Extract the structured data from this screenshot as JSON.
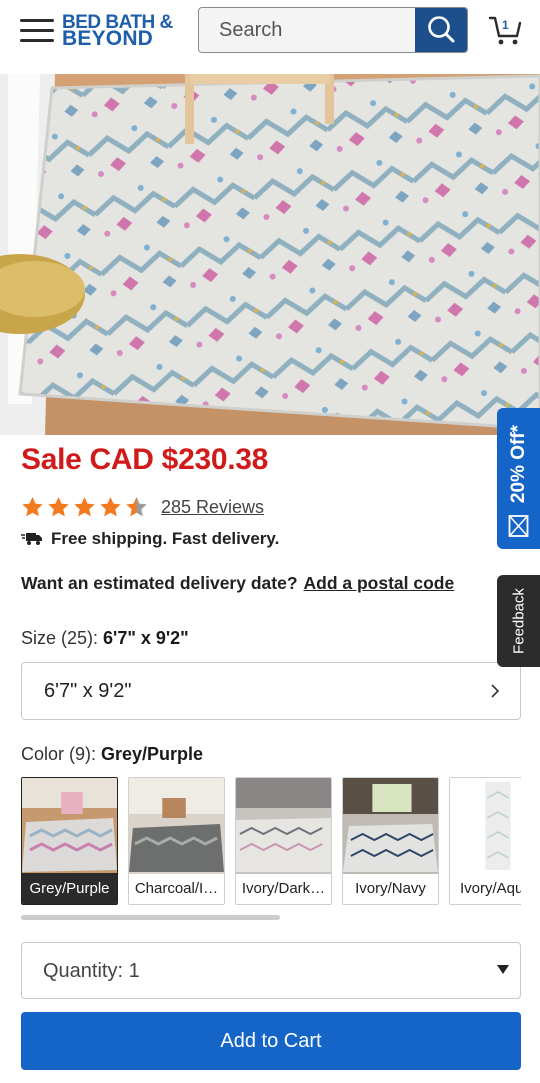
{
  "header": {
    "logo_line1": "BED BATH &",
    "logo_line2": "BEYOND",
    "search_placeholder": "Search",
    "cart_count": "1"
  },
  "product": {
    "price": "Sale CAD $230.38",
    "rating": 4.5,
    "reviews": "285 Reviews",
    "shipping": "Free shipping. Fast delivery.",
    "delivery_prompt": "Want an estimated delivery date?",
    "delivery_link": "Add a postal code",
    "size_label": "Size (25): ",
    "size_selected": "6'7\" x 9'2\"",
    "size_value": "6'7\" x 9'2\"",
    "color_label": "Color (9): ",
    "color_selected": "Grey/Purple",
    "swatches": [
      {
        "label": "Grey/Purple"
      },
      {
        "label": "Charcoal/I…"
      },
      {
        "label": "Ivory/Dark…"
      },
      {
        "label": "Ivory/Navy"
      },
      {
        "label": "Ivory/Aqu"
      }
    ],
    "quantity": "Quantity: 1",
    "add_to_cart": "Add to Cart"
  },
  "side_tabs": {
    "promo": "20% Off*",
    "feedback": "Feedback"
  },
  "colors": {
    "price_red": "#d11b1b",
    "brand_blue": "#1d5fa8",
    "button_blue": "#1565c8",
    "star_orange": "#f47a20"
  },
  "icons": [
    "menu-icon",
    "search-icon",
    "cart-icon",
    "star-icon",
    "truck-icon",
    "chevron-right-icon",
    "caret-down-icon",
    "envelope-icon"
  ]
}
